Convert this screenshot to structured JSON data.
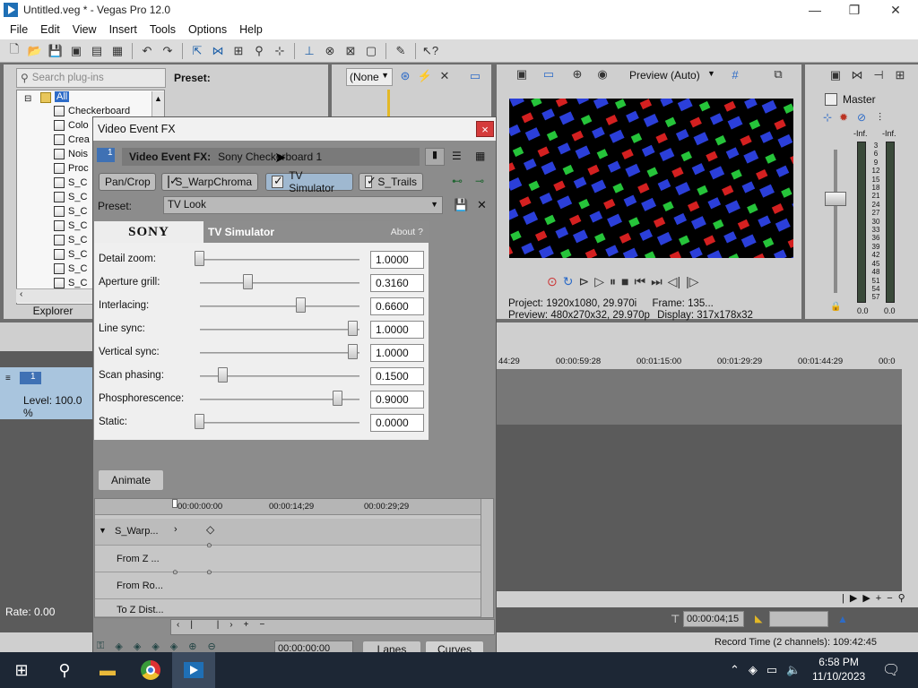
{
  "window": {
    "title": "Untitled.veg * - Vegas Pro 12.0",
    "minimize": "—",
    "maximize": "❐",
    "close": "✕"
  },
  "menu": [
    "File",
    "Edit",
    "View",
    "Insert",
    "Tools",
    "Options",
    "Help"
  ],
  "toolbar_icons": [
    "new-icon",
    "open-icon",
    "save-icon",
    "save-as-icon",
    "render-icon",
    "properties-icon",
    "undo-icon",
    "redo-icon",
    "normal-edit-tool-icon",
    "envelope-tool-icon",
    "selection-tool-icon",
    "zoom-tool-icon",
    "snapping-icon",
    "auto-ripple-icon",
    "lock-envelopes-icon",
    "ignore-grouping-icon",
    "cut-icon",
    "copy-icon",
    "paste-icon",
    "help-icon"
  ],
  "plugins": {
    "search_placeholder": "Search plug-ins",
    "preset_label": "Preset:",
    "root": "All",
    "items": [
      "Checkerboard",
      "Colo",
      "Crea",
      "Nois",
      "Proc",
      "S_C",
      "S_C",
      "S_C",
      "S_C",
      "S_C",
      "S_C",
      "S_C",
      "S_C"
    ],
    "explorer_tab": "Explorer"
  },
  "trimmer": {
    "preset_value": "(None"
  },
  "preview": {
    "mode": "Preview (Auto)",
    "project_label": "Project:",
    "project_value": "1920x1080, 29.970i",
    "frame_label": "Frame:",
    "frame_value": "135...",
    "preview_label": "Preview:",
    "preview_value": "480x270x32, 29.970p",
    "display_label": "Display:",
    "display_value": "317x178x32"
  },
  "mixer": {
    "title": "Master",
    "inf_left": "-Inf.",
    "inf_right": "-Inf.",
    "scale": [
      "3",
      "6",
      "9",
      "12",
      "15",
      "18",
      "21",
      "24",
      "27",
      "30",
      "33",
      "36",
      "39",
      "42",
      "45",
      "48",
      "51",
      "54",
      "57"
    ],
    "bottom_left": "0.0",
    "bottom_right": "0.0"
  },
  "timeline": {
    "ruler": [
      "44:29",
      "00:00:59:28",
      "00:01:15:00",
      "00:01:29:29",
      "00:01:44:29",
      "00:0"
    ],
    "track_level": "Level: 100.0 %",
    "track_num": "1",
    "rate": "Rate: 0.00",
    "cursor_time": "00:00:04;15",
    "record_time": "Record Time (2 channels): 109:42:45"
  },
  "dialog": {
    "title": "Video Event FX",
    "close": "×",
    "fx_label": "Video Event FX:",
    "fx_value": "Sony Checkerboard 1",
    "track_num": "1",
    "chain": [
      {
        "label": "Pan/Crop",
        "checkbox": false,
        "active": false
      },
      {
        "label": "S_WarpChroma",
        "checkbox": true,
        "active": false
      },
      {
        "label": "TV Simulator",
        "checkbox": true,
        "active": true
      },
      {
        "label": "S_Trails",
        "checkbox": true,
        "active": false
      }
    ],
    "preset_label": "Preset:",
    "preset_value": "TV Look",
    "plugin": {
      "brand": "SONY",
      "name": "TV Simulator",
      "about": "About",
      "help": "?",
      "params": [
        {
          "label": "Detail zoom:",
          "value": "1.0000",
          "level": 0.0
        },
        {
          "label": "Aperture grill:",
          "value": "0.3160",
          "level": 0.316
        },
        {
          "label": "Interlacing:",
          "value": "0.6600",
          "level": 0.66
        },
        {
          "label": "Line sync:",
          "value": "1.0000",
          "level": 1.0
        },
        {
          "label": "Vertical sync:",
          "value": "1.0000",
          "level": 1.0
        },
        {
          "label": "Scan phasing:",
          "value": "0.1500",
          "level": 0.15
        },
        {
          "label": "Phosphorescence:",
          "value": "0.9000",
          "level": 0.9
        },
        {
          "label": "Static:",
          "value": "0.0000",
          "level": 0.0
        }
      ]
    },
    "animate": "Animate",
    "keyframes": {
      "ruler": [
        "00:00:00:00",
        "00:00:14;29",
        "00:00:29;29"
      ],
      "rows": [
        "S_Warp...",
        "From Z ...",
        "From Ro...",
        "To Z Dist..."
      ],
      "time": "00:00:00:00",
      "lanes_tab": "Lanes",
      "curves_tab": "Curves"
    }
  },
  "taskbar": {
    "time": "6:58 PM",
    "date": "11/10/2023"
  },
  "colors": {
    "accent": "#9fb8d0",
    "close_red": "#d53b3b",
    "taskbar": "#1d2735"
  }
}
